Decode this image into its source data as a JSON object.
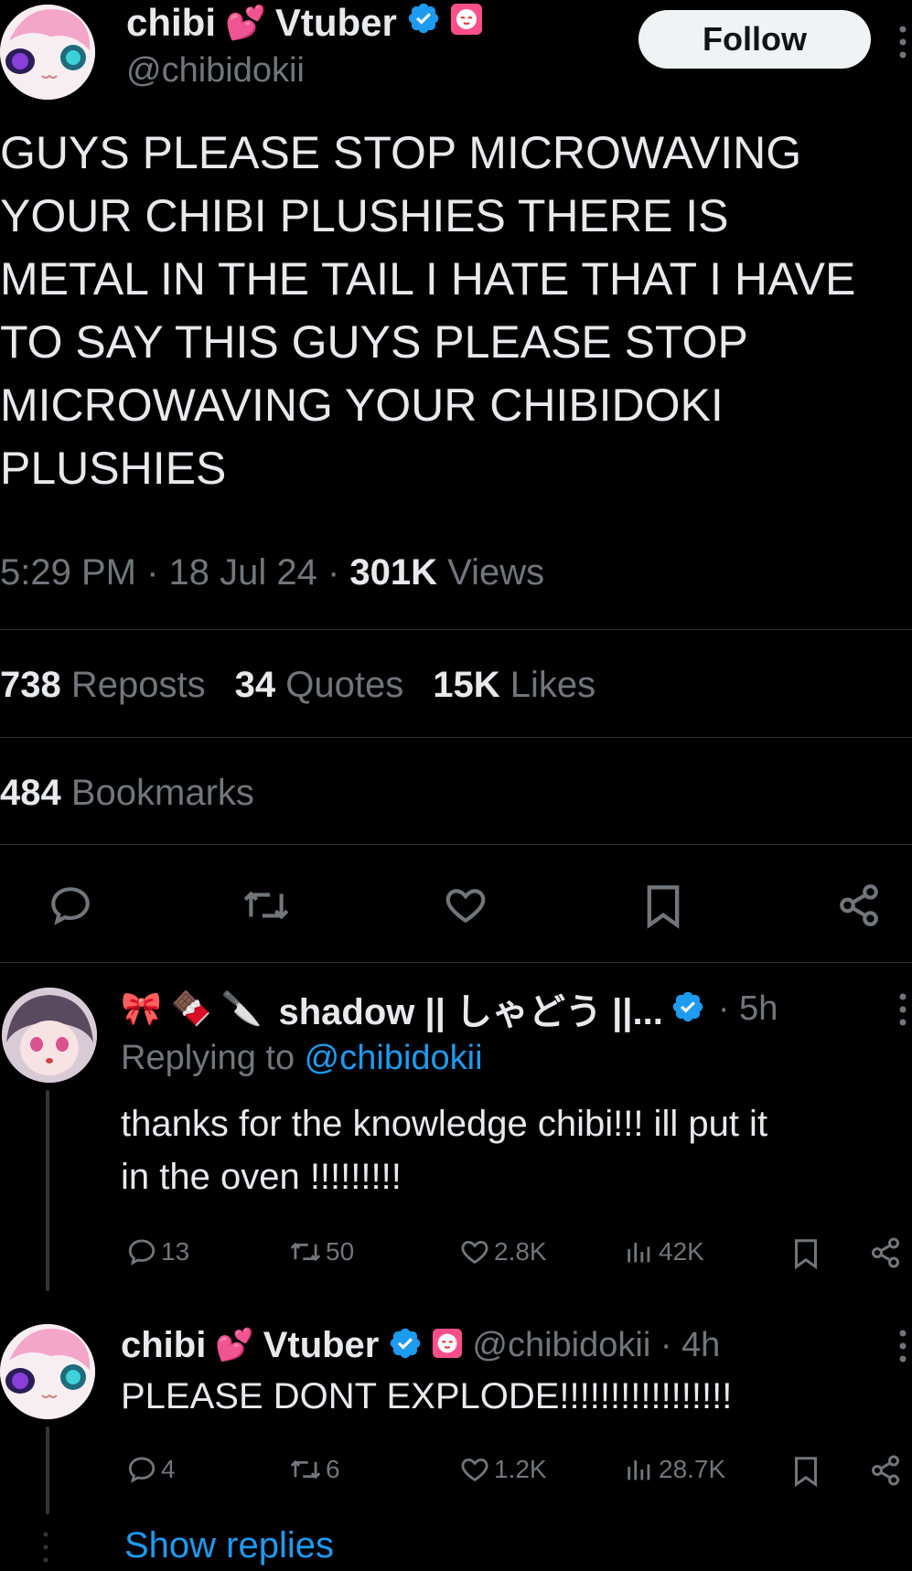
{
  "tweet": {
    "author_name_part1": "chibi",
    "author_emoji": "💕",
    "author_name_part2": "Vtuber",
    "handle": "@chibidokii",
    "follow_label": "Follow",
    "text": "GUYS PLEASE STOP MICROWAVING YOUR CHIBI PLUSHIES THERE IS METAL IN THE TAIL I HATE THAT I HAVE TO SAY THIS GUYS PLEASE STOP MICROWAVING YOUR CHIBIDOKI PLUSHIES",
    "text_lines": [
      "GUYS PLEASE STOP MICROWAVING",
      "YOUR CHIBI PLUSHIES THERE IS",
      "METAL IN THE TAIL I HATE THAT I HAVE",
      "TO SAY THIS GUYS PLEASE STOP",
      "MICROWAVING YOUR CHIBIDOKI",
      "PLUSHIES"
    ],
    "time": "5:29 PM · 18 Jul 24 · ",
    "views_count": "301K",
    "views_label": "Views",
    "reposts_count": "738",
    "reposts_label": "Reposts",
    "quotes_count": "34",
    "quotes_label": "Quotes",
    "likes_count": "15K",
    "likes_label": "Likes",
    "bookmarks_count": "484",
    "bookmarks_label": "Bookmarks"
  },
  "replies": [
    {
      "emoji_prefix": "🎀🍫🔪",
      "name": "shadow || しゃどう ||...",
      "age": "· 5h",
      "replying_prefix": "Replying to ",
      "replying_handle": "@chibidokii",
      "text_lines": [
        "thanks for the knowledge chibi!!! ill put it",
        "in the oven !!!!!!!!!"
      ],
      "replies": "13",
      "reposts": "50",
      "likes": "2.8K",
      "views": "42K"
    },
    {
      "name_part1": "chibi",
      "emoji": "💕",
      "name_part2": "Vtuber",
      "handle_age": "@chibidokii · 4h",
      "text": "PLEASE DONT EXPLODE!!!!!!!!!!!!!!!!!",
      "replies": "4",
      "reposts": "6",
      "likes": "1.2K",
      "views": "28.7K"
    }
  ],
  "show_replies_label": "Show replies",
  "colors": {
    "background": "#000000",
    "text": "#e7e9ea",
    "muted": "#71767b",
    "accent": "#1d9bf0",
    "divider": "#2f3336"
  },
  "icons": [
    "reply-icon",
    "repost-icon",
    "like-icon",
    "bookmark-icon",
    "share-icon",
    "views-icon",
    "verified-badge-icon",
    "affiliate-badge-icon",
    "more-icon"
  ]
}
